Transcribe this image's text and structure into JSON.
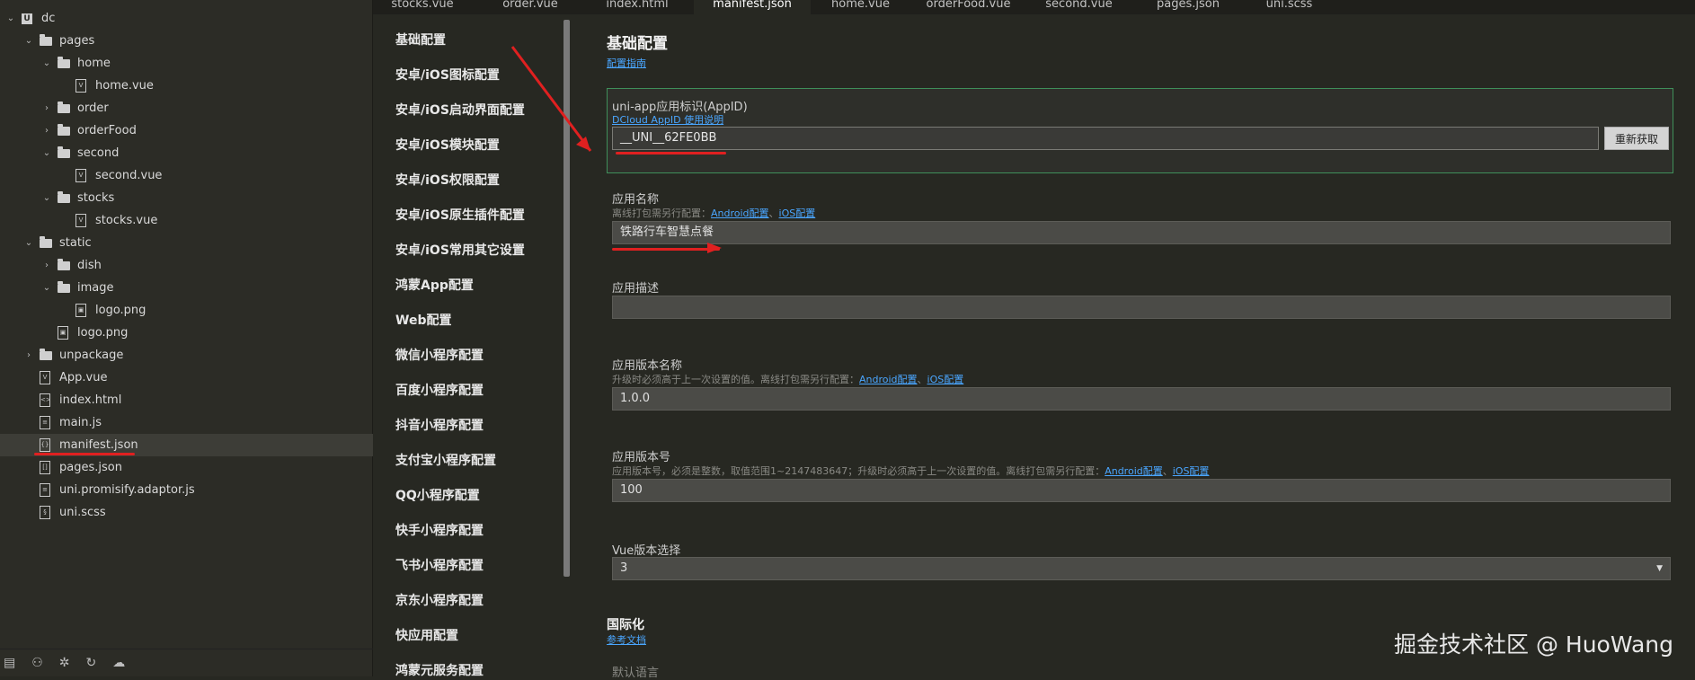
{
  "explorer": {
    "items": [
      {
        "label": "dc",
        "type": "project",
        "depth": 0,
        "chev": "open"
      },
      {
        "label": "pages",
        "type": "folder",
        "depth": 1,
        "chev": "open"
      },
      {
        "label": "home",
        "type": "folder",
        "depth": 2,
        "chev": "open"
      },
      {
        "label": "home.vue",
        "type": "vue",
        "depth": 3,
        "chev": "none"
      },
      {
        "label": "order",
        "type": "folder",
        "depth": 2,
        "chev": "closed"
      },
      {
        "label": "orderFood",
        "type": "folder",
        "depth": 2,
        "chev": "closed"
      },
      {
        "label": "second",
        "type": "folder",
        "depth": 2,
        "chev": "open"
      },
      {
        "label": "second.vue",
        "type": "vue",
        "depth": 3,
        "chev": "none"
      },
      {
        "label": "stocks",
        "type": "folder",
        "depth": 2,
        "chev": "open"
      },
      {
        "label": "stocks.vue",
        "type": "vue",
        "depth": 3,
        "chev": "none"
      },
      {
        "label": "static",
        "type": "folder",
        "depth": 1,
        "chev": "open"
      },
      {
        "label": "dish",
        "type": "folder",
        "depth": 2,
        "chev": "closed"
      },
      {
        "label": "image",
        "type": "folder",
        "depth": 2,
        "chev": "open"
      },
      {
        "label": "logo.png",
        "type": "image",
        "depth": 3,
        "chev": "none"
      },
      {
        "label": "logo.png",
        "type": "image",
        "depth": 2,
        "chev": "none"
      },
      {
        "label": "unpackage",
        "type": "folder",
        "depth": 1,
        "chev": "closed"
      },
      {
        "label": "App.vue",
        "type": "vue",
        "depth": 1,
        "chev": "none"
      },
      {
        "label": "index.html",
        "type": "html",
        "depth": 1,
        "chev": "none"
      },
      {
        "label": "main.js",
        "type": "js",
        "depth": 1,
        "chev": "none"
      },
      {
        "label": "manifest.json",
        "type": "json",
        "depth": 1,
        "chev": "none",
        "selected": true
      },
      {
        "label": "pages.json",
        "type": "jsonarr",
        "depth": 1,
        "chev": "none"
      },
      {
        "label": "uni.promisify.adaptor.js",
        "type": "js",
        "depth": 1,
        "chev": "none"
      },
      {
        "label": "uni.scss",
        "type": "scss",
        "depth": 1,
        "chev": "none"
      }
    ]
  },
  "tabs": [
    {
      "label": "stocks.vue"
    },
    {
      "label": "order.vue"
    },
    {
      "label": "index.html"
    },
    {
      "label": "manifest.json",
      "active": true
    },
    {
      "label": "home.vue"
    },
    {
      "label": "orderFood.vue"
    },
    {
      "label": "second.vue"
    },
    {
      "label": "pages.json"
    },
    {
      "label": "uni.scss"
    }
  ],
  "categories": [
    "基础配置",
    "安卓/iOS图标配置",
    "安卓/iOS启动界面配置",
    "安卓/iOS模块配置",
    "安卓/iOS权限配置",
    "安卓/iOS原生插件配置",
    "安卓/iOS常用其它设置",
    "鸿蒙App配置",
    "Web配置",
    "微信小程序配置",
    "百度小程序配置",
    "抖音小程序配置",
    "支付宝小程序配置",
    "QQ小程序配置",
    "快手小程序配置",
    "飞书小程序配置",
    "京东小程序配置",
    "快应用配置",
    "鸿蒙元服务配置"
  ],
  "form": {
    "section_title": "基础配置",
    "guide_link": "配置指南",
    "appid": {
      "label": "uni-app应用标识(AppID)",
      "help_link": "DCloud AppID 使用说明",
      "value": "__UNI__62FE0BB",
      "button": "重新获取"
    },
    "app_name": {
      "label": "应用名称",
      "hint": "离线打包需另行配置：",
      "android_link": "Android配置",
      "sep": "、",
      "ios_link": "iOS配置",
      "value": "铁路行车智慧点餐"
    },
    "app_desc": {
      "label": "应用描述",
      "value": ""
    },
    "version_name": {
      "label": "应用版本名称",
      "hint": "升级时必须高于上一次设置的值。离线打包需另行配置：",
      "android_link": "Android配置",
      "sep": "、",
      "ios_link": "iOS配置",
      "value": "1.0.0"
    },
    "version_code": {
      "label": "应用版本号",
      "hint": "应用版本号，必须是整数，取值范围1~2147483647；升级时必须高于上一次设置的值。离线打包需另行配置：",
      "android_link": "Android配置",
      "sep": "、",
      "ios_link": "iOS配置",
      "value": "100"
    },
    "vue_version": {
      "label": "Vue版本选择",
      "value": "3"
    },
    "i18n": {
      "title": "国际化",
      "link": "参考文档",
      "default_lang_label": "默认语言"
    }
  },
  "watermark": "掘金技术社区 @ HuoWang",
  "colors": {
    "accent_link": "#4aa6ff",
    "annotation_red": "#e02020",
    "appid_border": "#3f8f5a"
  }
}
